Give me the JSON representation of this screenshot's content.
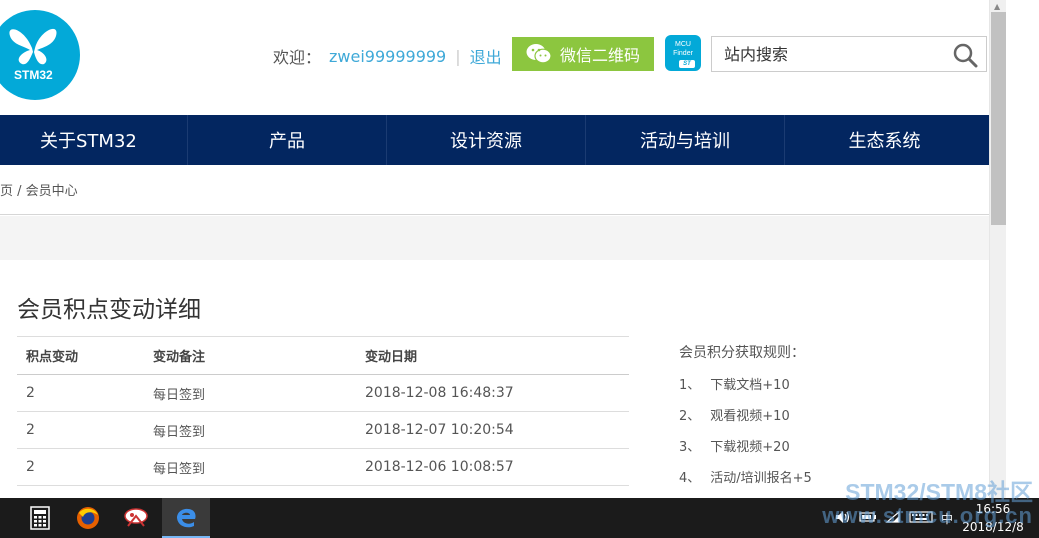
{
  "header": {
    "logo_text": "STM32",
    "welcome_label": "欢迎：",
    "username": "zwei99999999",
    "separator": "|",
    "logout": "退出",
    "wechat_button": "微信二维码",
    "mcu_badge_line1": "MCU",
    "mcu_badge_line2": "Finder",
    "mcu_badge_brand": "ST",
    "search_placeholder": "站内搜索"
  },
  "nav": {
    "items": [
      {
        "label": "关于STM32"
      },
      {
        "label": "产品"
      },
      {
        "label": "设计资源"
      },
      {
        "label": "活动与培训"
      },
      {
        "label": "生态系统"
      }
    ]
  },
  "breadcrumb": "页 / 会员中心",
  "main": {
    "title": "会员积点变动详细",
    "table": {
      "headers": [
        "积点变动",
        "变动备注",
        "变动日期"
      ],
      "rows": [
        {
          "change": "2",
          "remark": "每日签到",
          "date": "2018-12-08 16:48:37"
        },
        {
          "change": "2",
          "remark": "每日签到",
          "date": "2018-12-07 10:20:54"
        },
        {
          "change": "2",
          "remark": "每日签到",
          "date": "2018-12-06 10:08:57"
        }
      ]
    },
    "rules": {
      "title": "会员积分获取规则：",
      "items": [
        {
          "num": "1、",
          "text": "下载文档+10"
        },
        {
          "num": "2、",
          "text": "观看视频+10"
        },
        {
          "num": "3、",
          "text": "下载视频+20"
        },
        {
          "num": "4、",
          "text": "活动/培训报名+5"
        }
      ]
    }
  },
  "taskbar": {
    "ime": "中",
    "time": "16:56",
    "date": "2018/12/8"
  },
  "watermark": {
    "line1": "STM32/STM8社区",
    "line2": "www.stmcu.org.cn"
  },
  "colors": {
    "nav_bg": "#032660",
    "accent_blue": "#3fa9d8",
    "wechat_green": "#8cc63f",
    "logo_blue": "#03a9d8"
  }
}
